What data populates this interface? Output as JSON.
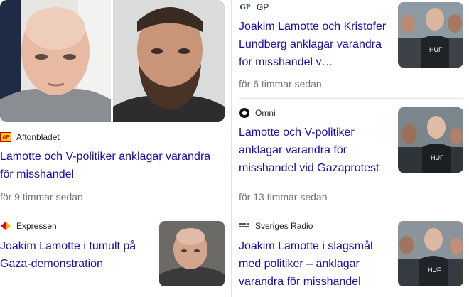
{
  "articles": [
    {
      "source": "Aftonbladet",
      "source_logo": "aftonbladet-logo",
      "headline": "Lamotte och V-politiker anklagar varandra för misshandel",
      "time": "för 9 timmar sedan"
    },
    {
      "source": "Expressen",
      "source_logo": "expressen-logo",
      "headline": "Joakim Lamotte i tumult på Gaza-demonstration",
      "time": ""
    },
    {
      "source": "GP",
      "source_logo": "gp-logo",
      "headline": "Joakim Lamotte och Kristofer Lundberg anklagar varandra för misshandel v…",
      "time": "för 6 timmar sedan"
    },
    {
      "source": "Omni",
      "source_logo": "omni-logo",
      "headline": "Lamotte och V-politiker anklagar varandra för misshandel vid Gazaprotest",
      "time": "för 13 timmar sedan"
    },
    {
      "source": "Sveriges Radio",
      "source_logo": "sveriges-radio-logo",
      "headline": "Joakim Lamotte i slagsmål med politiker – anklagar varandra för misshandel",
      "time": ""
    }
  ],
  "logos": {
    "aftonbladet": "AF",
    "gp": "GP"
  },
  "colors": {
    "headline": "#1a0dab",
    "meta": "#70757a",
    "divider": "#e3e3e3"
  }
}
